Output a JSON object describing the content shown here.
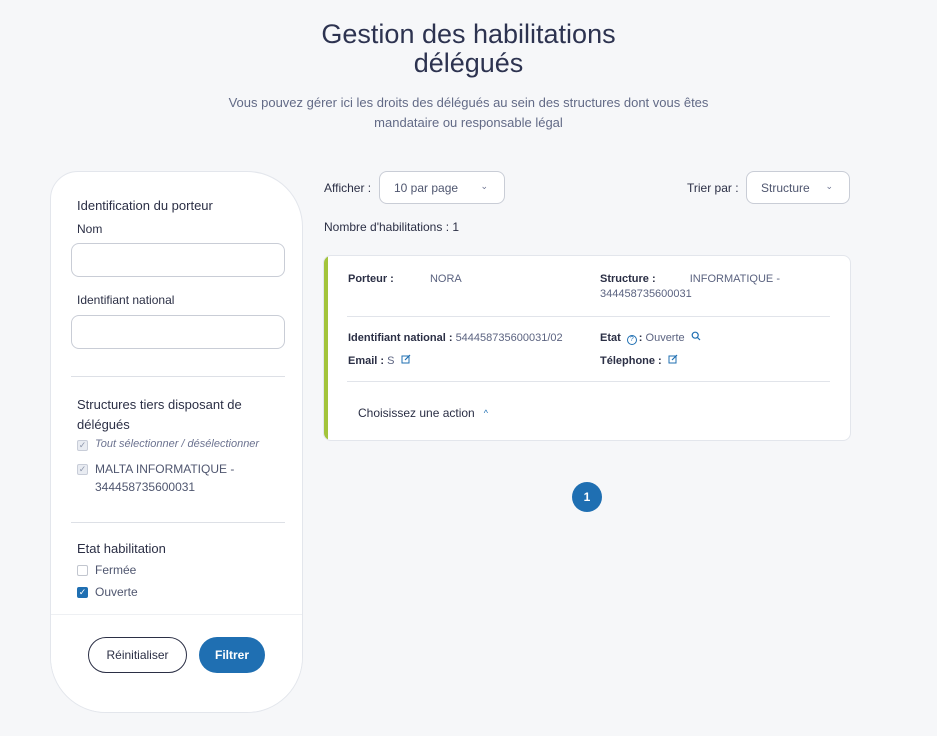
{
  "header": {
    "title": "Gestion des habilitations délégués",
    "subtitle": "Vous pouvez gérer ici les droits des délégués au sein des structures dont vous êtes mandataire ou responsable légal"
  },
  "sidebar": {
    "section_porteur": "Identification du porteur",
    "nom_label": "Nom",
    "nom_value": "",
    "id_label": "Identifiant national",
    "id_value": "",
    "section_structures": "Structures tiers disposant de délégués",
    "select_all": "Tout sélectionner / désélectionner",
    "structure_option": "MALTA INFORMATIQUE - 344458735600031",
    "section_etat": "Etat habilitation",
    "etat_options": [
      "Fermée",
      "Ouverte"
    ],
    "reset_label": "Réinitialiser",
    "filter_label": "Filtrer"
  },
  "toolbar": {
    "afficher_label": "Afficher :",
    "per_page": "10 par page",
    "trier_label": "Trier par :",
    "sort_by": "Structure",
    "count_text": "Nombre d'habilitations : 1"
  },
  "card": {
    "porteur_label": "Porteur :",
    "porteur_value": "NORA",
    "structure_label": "Structure :",
    "structure_value": "INFORMATIQUE - 344458735600031",
    "id_label": "Identifiant national :",
    "id_value": "544458735600031/02",
    "etat_label": "Etat",
    "etat_value": "Ouverte",
    "email_label": "Email :",
    "email_value": "S",
    "tel_label": "Télephone :",
    "action_label": "Choisissez une action"
  },
  "pagination": {
    "current": "1"
  },
  "colors": {
    "primary": "#1f6fb2",
    "accent": "#a3c43b",
    "text": "#2b2f45"
  },
  "icons": [
    "chevron-down-icon",
    "help-icon",
    "search-icon",
    "edit-icon",
    "chevron-up-icon",
    "check-icon"
  ]
}
